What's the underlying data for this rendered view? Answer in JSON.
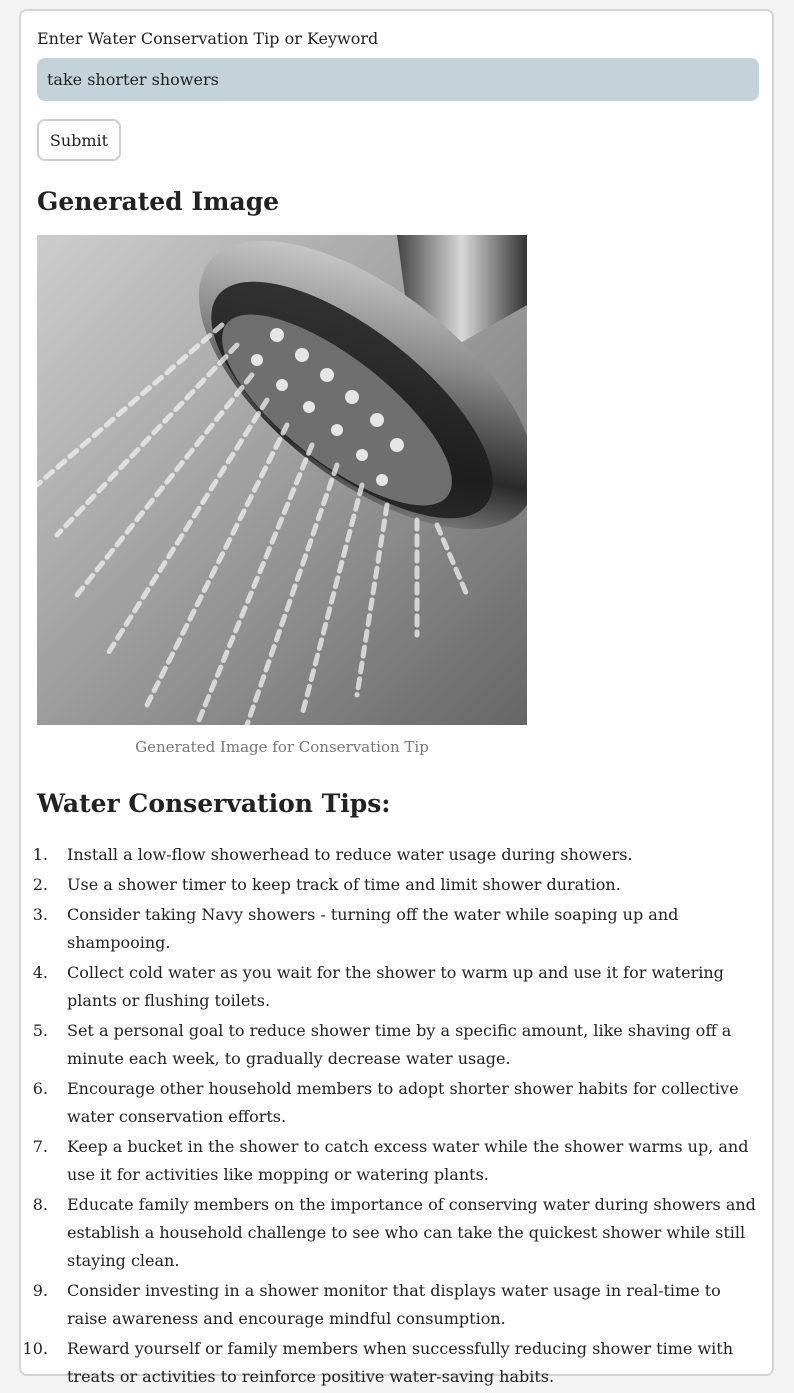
{
  "form": {
    "label": "Enter Water Conservation Tip or Keyword",
    "input_value": "take shorter showers",
    "submit_label": "Submit"
  },
  "image_section": {
    "title": "Generated Image",
    "caption": "Generated Image for Conservation Tip"
  },
  "tips_section": {
    "title": "Water Conservation Tips:",
    "tips": [
      "Install a low-flow showerhead to reduce water usage during showers.",
      "Use a shower timer to keep track of time and limit shower duration.",
      "Consider taking Navy showers - turning off the water while soaping up and shampooing.",
      "Collect cold water as you wait for the shower to warm up and use it for watering plants or flushing toilets.",
      "Set a personal goal to reduce shower time by a specific amount, like shaving off a minute each week, to gradually decrease water usage.",
      "Encourage other household members to adopt shorter shower habits for collective water conservation efforts.",
      "Keep a bucket in the shower to catch excess water while the shower warms up, and use it for activities like mopping or watering plants.",
      "Educate family members on the importance of conserving water during showers and establish a household challenge to see who can take the quickest shower while still staying clean.",
      "Consider investing in a shower monitor that displays water usage in real-time to raise awareness and encourage mindful consumption.",
      "Reward yourself or family members when successfully reducing shower time with treats or activities to reinforce positive water-saving habits."
    ]
  }
}
